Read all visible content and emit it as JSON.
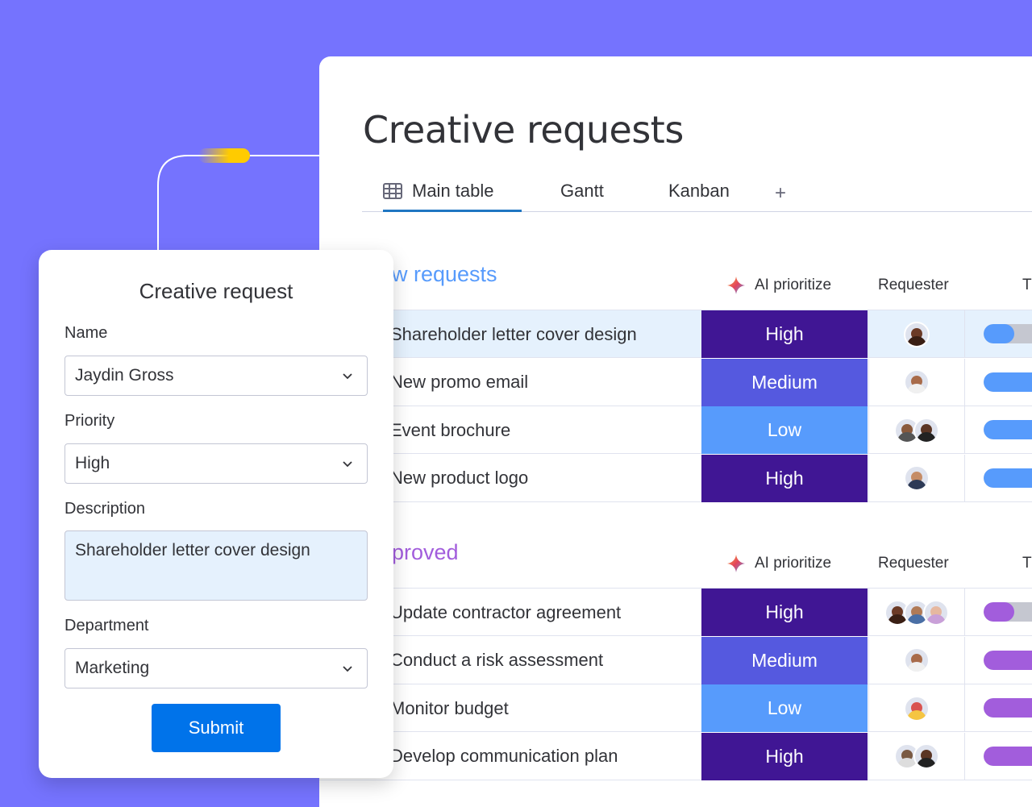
{
  "board": {
    "title": "Creative requests",
    "tabs": [
      {
        "label": "Main table",
        "active": true
      },
      {
        "label": "Gantt",
        "active": false
      },
      {
        "label": "Kanban",
        "active": false
      }
    ],
    "add_tab": "+"
  },
  "groups": [
    {
      "title": "w requests",
      "color": "#579bfc",
      "col_ai": "AI prioritize",
      "col_requester": "Requester",
      "col_next": "T",
      "timeline_color": "#579bfc",
      "rows": [
        {
          "name": "Shareholder letter cover design",
          "priority": "High",
          "selected": true
        },
        {
          "name": "New promo email",
          "priority": "Medium"
        },
        {
          "name": "Event brochure",
          "priority": "Low"
        },
        {
          "name": "New product logo",
          "priority": "High"
        }
      ]
    },
    {
      "title": "proved",
      "color": "#a25ddc",
      "col_ai": "AI prioritize",
      "col_requester": "Requester",
      "col_next": "T",
      "timeline_color": "#a25ddc",
      "rows": [
        {
          "name": "Update contractor agreement",
          "priority": "High"
        },
        {
          "name": "Conduct a risk assessment",
          "priority": "Medium"
        },
        {
          "name": "Monitor budget",
          "priority": "Low"
        },
        {
          "name": "Develop communication plan",
          "priority": "High"
        }
      ]
    }
  ],
  "form": {
    "title": "Creative request",
    "name_label": "Name",
    "name_value": "Jaydin Gross",
    "priority_label": "Priority",
    "priority_value": "High",
    "description_label": "Description",
    "description_value": "Shareholder letter cover design",
    "department_label": "Department",
    "department_value": "Marketing",
    "submit_label": "Submit"
  },
  "colors": {
    "background": "#7573fe",
    "high": "#401694",
    "medium": "#5559df",
    "low": "#579bfc",
    "submit": "#0073ea"
  },
  "icons": [
    "table-icon",
    "sparkle-icon",
    "chevron-down-icon",
    "plus-icon"
  ]
}
